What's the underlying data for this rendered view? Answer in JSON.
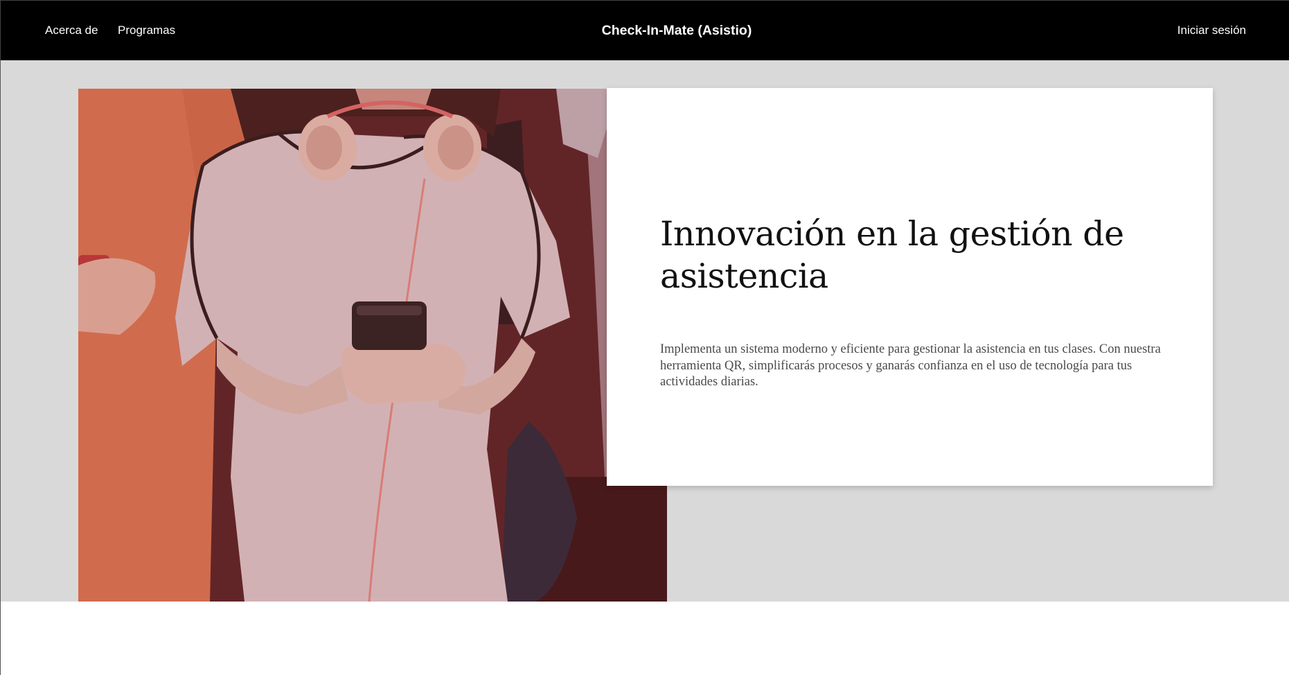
{
  "nav": {
    "about_label": "Acerca de",
    "programs_label": "Programas",
    "brand": "Check-In-Mate (Asistio)",
    "login_label": "Iniciar sesión"
  },
  "hero": {
    "title": "Innovación en la gestión de asistencia",
    "description": "Implementa un sistema moderno y eficiente para gestionar la asistencia en tus clases. Con nuestra herramienta QR, simplificarás procesos y ganarás confianza en el uso de tecnología para tus actividades diarias.",
    "photo_subject": "students-with-phones-photo"
  },
  "colors": {
    "nav_bg": "#000000",
    "nav_text": "#ffffff",
    "hero_bg": "#d9d9d9",
    "card_bg": "#ffffff",
    "title_color": "#111111",
    "body_text": "#4a4a4a",
    "photo_overlay": "#8a2a2a"
  }
}
